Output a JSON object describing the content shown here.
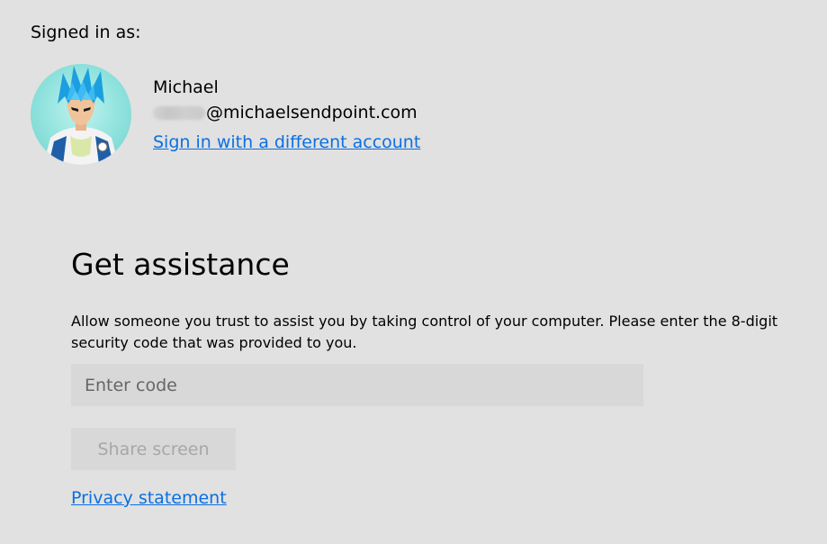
{
  "signed_in": {
    "label": "Signed in as:",
    "account": {
      "name": "Michael",
      "email_domain": "@michaelsendpoint.com",
      "avatar_icon": "user-avatar-icon"
    },
    "switch_account_link": "Sign in with a different account"
  },
  "assistance": {
    "title": "Get assistance",
    "description": "Allow someone you trust to assist you by taking control of your computer. Please enter the 8-digit security code that was provided to you.",
    "code_placeholder": "Enter code",
    "code_value": "",
    "share_button_label": "Share screen",
    "privacy_link": "Privacy statement"
  },
  "colors": {
    "background": "#e1e1e1",
    "link": "#0b6fe0",
    "input_background": "#d9d8d8",
    "disabled_text": "#a7a7a7"
  }
}
